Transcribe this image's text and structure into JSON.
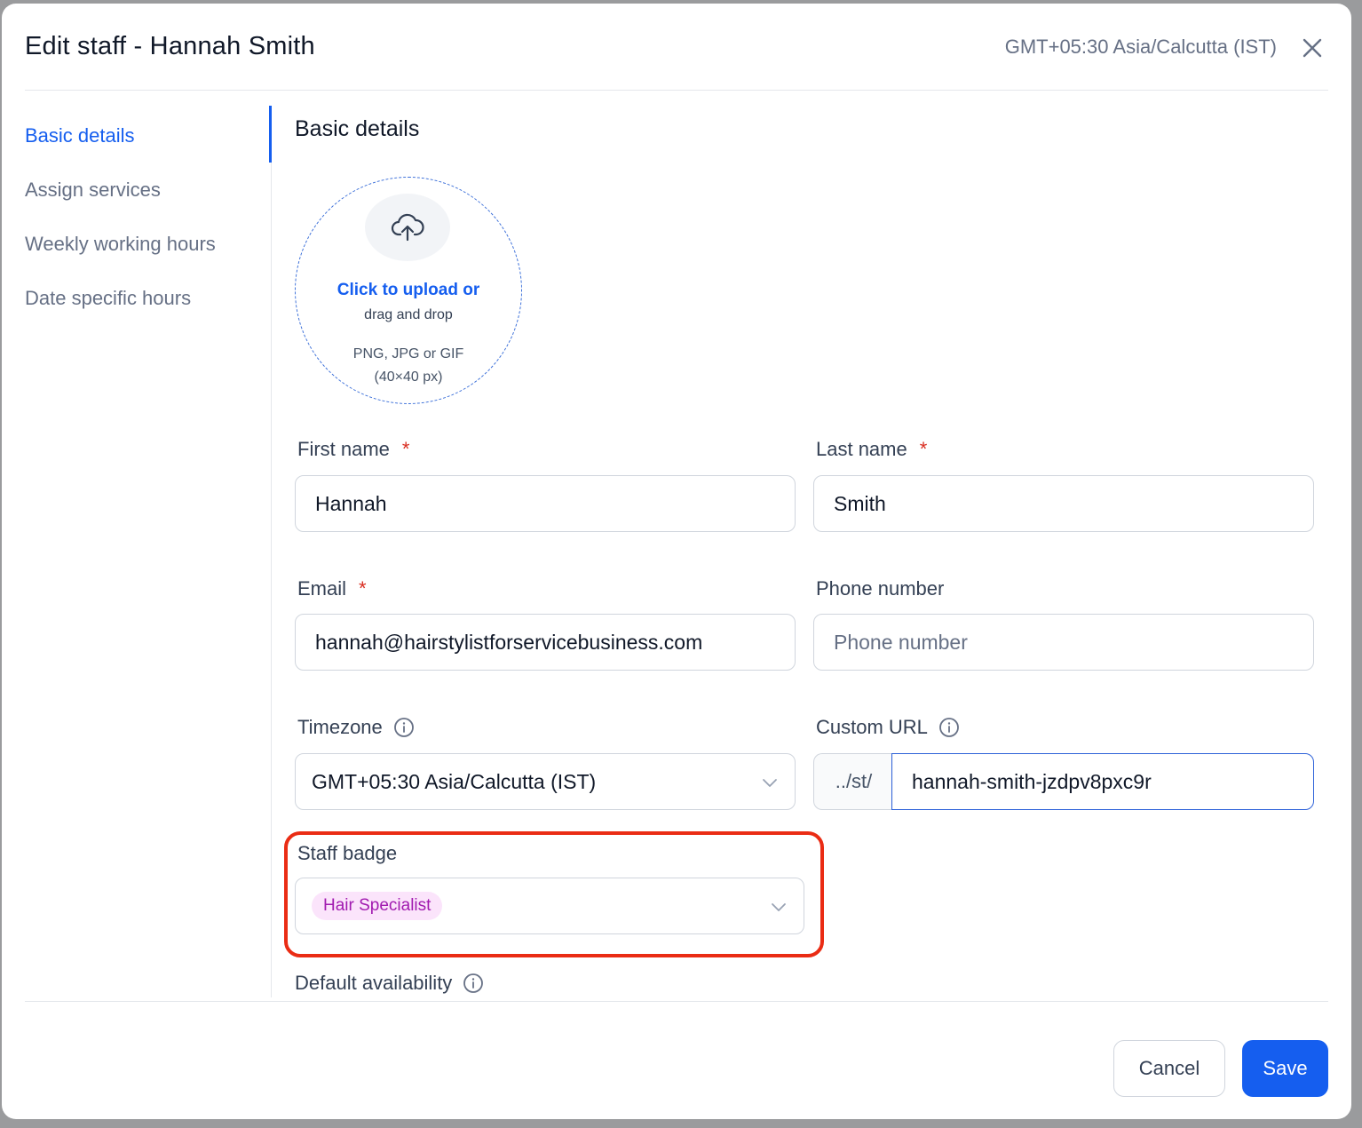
{
  "modal": {
    "title": "Edit staff - Hannah Smith",
    "timezone": "GMT+05:30 Asia/Calcutta (IST)"
  },
  "sidebar": {
    "items": [
      {
        "label": "Basic details",
        "active": true
      },
      {
        "label": "Assign services",
        "active": false
      },
      {
        "label": "Weekly working hours",
        "active": false
      },
      {
        "label": "Date specific hours",
        "active": false
      }
    ]
  },
  "section": {
    "title": "Basic details"
  },
  "upload": {
    "link": "Click to upload or",
    "sub": "drag and drop",
    "formats": "PNG, JPG or GIF",
    "size": "(40×40 px)"
  },
  "form": {
    "first_name": {
      "label": "First name",
      "required": "*",
      "value": "Hannah"
    },
    "last_name": {
      "label": "Last name",
      "required": "*",
      "value": "Smith"
    },
    "email": {
      "label": "Email",
      "required": "*",
      "value": "hannah@hairstylistforservicebusiness.com"
    },
    "phone": {
      "label": "Phone number",
      "placeholder": "Phone number",
      "value": ""
    },
    "timezone": {
      "label": "Timezone",
      "value": "GMT+05:30 Asia/Calcutta (IST)"
    },
    "custom_url": {
      "label": "Custom URL",
      "prefix": "../st/",
      "value": "hannah-smith-jzdpv8pxc9r"
    },
    "staff_badge": {
      "label": "Staff badge",
      "value": "Hair Specialist"
    },
    "default_availability": {
      "label": "Default availability"
    }
  },
  "footer": {
    "cancel": "Cancel",
    "save": "Save"
  },
  "colors": {
    "accent": "#155eef",
    "highlight": "#ea2c14",
    "badge_bg": "#fbe4fb",
    "badge_text": "#a11bb0"
  }
}
